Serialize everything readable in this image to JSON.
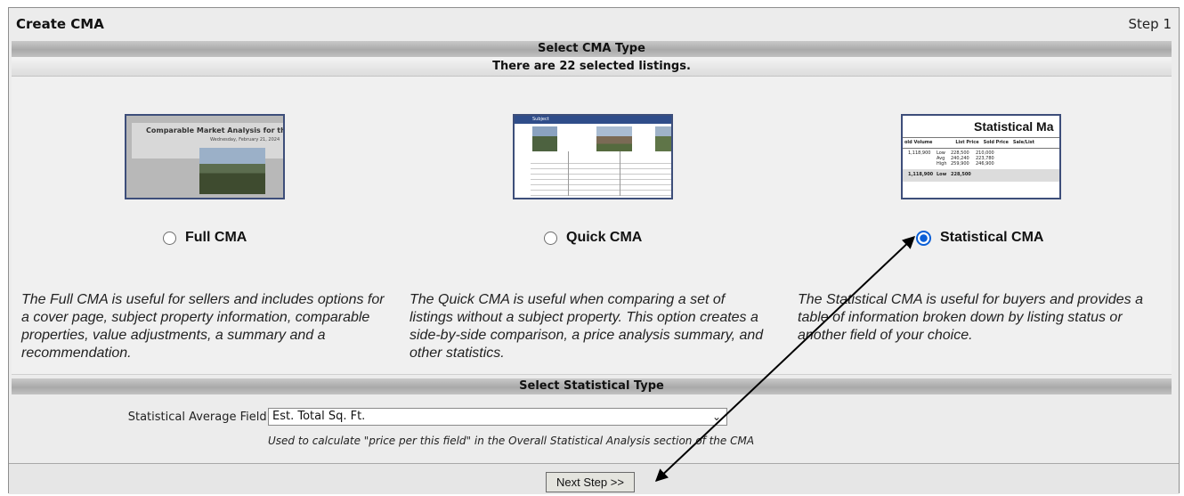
{
  "header": {
    "title": "Create CMA",
    "step": "Step 1"
  },
  "select_type": {
    "bar_label": "Select CMA Type",
    "selected_count_text": "There are 22 selected listings."
  },
  "options": [
    {
      "label": "Full CMA",
      "selected": false,
      "description": "The Full CMA is useful for sellers and includes options for a cover page, subject property information, comparable properties, value adjustments, a summary and a recommendation.",
      "thumb_text": "Comparable Market Analysis for th",
      "thumb_subtext": "Wednesday, February 21, 2024"
    },
    {
      "label": "Quick CMA",
      "selected": false,
      "description": "The Quick CMA is useful when comparing a set of listings without a subject property. This option creates a side-by-side comparison, a price analysis summary, and other statistics.",
      "thumb_text": "Subject"
    },
    {
      "label": "Statistical CMA",
      "selected": true,
      "description": "The Statistical CMA is useful for buyers and provides a table of information broken down by listing status or another field of your choice.",
      "thumb_text": "Statistical Ma",
      "thumb_cols": [
        "old Volume",
        "List Price",
        "Sold Price",
        "Sale/List"
      ],
      "thumb_rows": [
        [
          "1,118,900",
          "Low",
          "228,500",
          "210,000"
        ],
        [
          "",
          "Avg",
          "240,240",
          "223,780"
        ],
        [
          "",
          "High",
          "259,900",
          "246,900"
        ],
        [
          "1,118,900",
          "Low",
          "228,500",
          ""
        ]
      ]
    }
  ],
  "stat_type": {
    "bar_label": "Select Statistical Type",
    "field_label": "Statistical Average Field:",
    "field_value": "Est. Total Sq. Ft.",
    "hint": "Used to calculate \"price per this field\" in the Overall Statistical Analysis section of the CMA"
  },
  "footer": {
    "next_label": "Next Step >>"
  },
  "colors": {
    "radio_selected": "#0b5fd7",
    "thumb_border": "#3d4e7a"
  }
}
